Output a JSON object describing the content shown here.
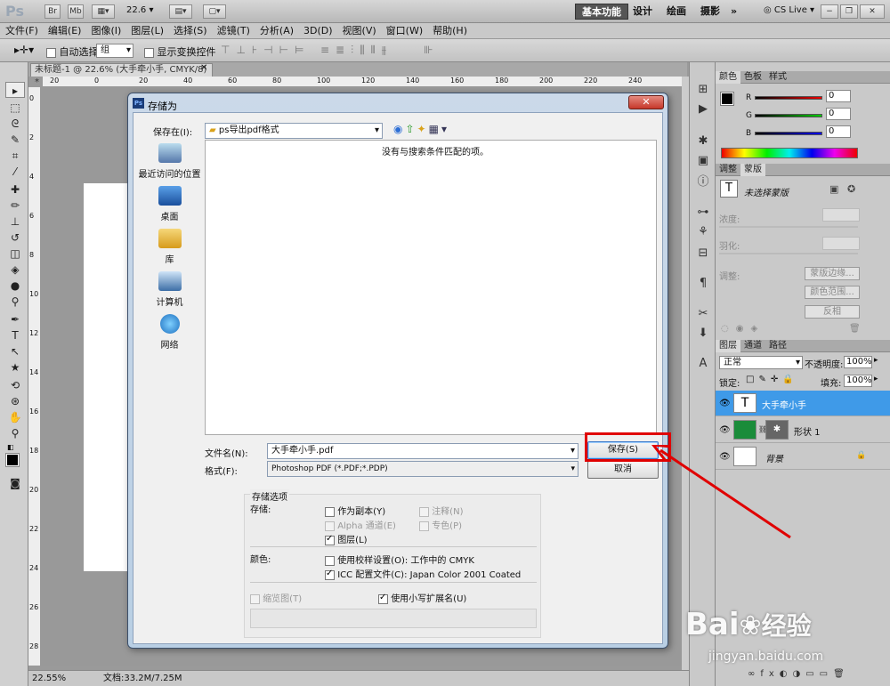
{
  "appbar": {
    "logo": "Ps",
    "br": "Br",
    "mb": "Mb",
    "zoom": "22.6",
    "workspaces": [
      "基本功能",
      "设计",
      "绘画",
      "摄影"
    ],
    "more": "»",
    "cslive": "CS Live"
  },
  "menu": [
    "文件(F)",
    "编辑(E)",
    "图像(I)",
    "图层(L)",
    "选择(S)",
    "滤镜(T)",
    "分析(A)",
    "3D(D)",
    "视图(V)",
    "窗口(W)",
    "帮助(H)"
  ],
  "options": {
    "auto_select": "自动选择:",
    "auto_select_value": "组",
    "show_transform": "显示变换控件"
  },
  "document": {
    "tab_title": "未标题-1 @ 22.6% (大手牵小手, CMYK/8) *",
    "ruler_h": [
      "20",
      "0",
      "20",
      "40",
      "60",
      "80",
      "100",
      "120",
      "140",
      "160",
      "180",
      "200",
      "220",
      "240"
    ],
    "ruler_v": [
      "0",
      "2",
      "4",
      "6",
      "8",
      "10",
      "12",
      "14",
      "16",
      "18",
      "20",
      "22",
      "24",
      "26",
      "28"
    ]
  },
  "status": {
    "zoom": "22.55%",
    "doc": "文档:33.2M/7.25M"
  },
  "color_panel": {
    "tabs": [
      "颜色",
      "色板",
      "样式"
    ],
    "r_label": "R",
    "g_label": "G",
    "b_label": "B",
    "r": "0",
    "g": "0",
    "b": "0"
  },
  "adjust_panel": {
    "tabs": [
      "调整",
      "蒙版"
    ],
    "no_mask": "未选择蒙版",
    "density": "浓度:",
    "feather": "羽化:",
    "refine": "调整:",
    "edge_btn": "蒙版边缘...",
    "range_btn": "颜色范围...",
    "invert_btn": "反相"
  },
  "layers_panel": {
    "tabs": [
      "图层",
      "通道",
      "路径"
    ],
    "blend": "正常",
    "opacity_label": "不透明度:",
    "opacity": "100%",
    "lock_label": "锁定:",
    "fill_label": "填充:",
    "fill": "100%",
    "layers": [
      {
        "name": "大手牵小手",
        "selected": true
      },
      {
        "name": "形状 1",
        "selected": false
      },
      {
        "name": "背景",
        "selected": false
      }
    ]
  },
  "dialog": {
    "title": "存储为",
    "save_in_label": "保存在(I):",
    "save_in_value": "ps导出pdf格式",
    "empty_msg": "没有与搜索条件匹配的项。",
    "places": [
      "最近访问的位置",
      "桌面",
      "库",
      "计算机",
      "网络"
    ],
    "filename_label": "文件名(N):",
    "filename": "大手牵小手.pdf",
    "format_label": "格式(F):",
    "format": "Photoshop PDF (*.PDF;*.PDP)",
    "save_btn": "保存(S)",
    "cancel_btn": "取消",
    "save_options_title": "存储选项",
    "store_label": "存储:",
    "as_copy": "作为副本(Y)",
    "annotations": "注释(N)",
    "alpha": "Alpha 通道(E)",
    "spot": "专色(P)",
    "layers": "图层(L)",
    "color_label": "颜色:",
    "use_proof": "使用校样设置(O):",
    "proof_value": "工作中的 CMYK",
    "icc": "ICC 配置文件(C):",
    "icc_value": "Japan Color 2001 Coated",
    "thumbnail": "缩览图(T)",
    "lowercase": "使用小写扩展名(U)"
  },
  "watermark": {
    "brand": "Bai",
    "brand2": "经验",
    "url": "jingyan.baidu.com"
  },
  "colors": {
    "selected_layer": "#3f9ae8",
    "annotation": "#e00000"
  }
}
